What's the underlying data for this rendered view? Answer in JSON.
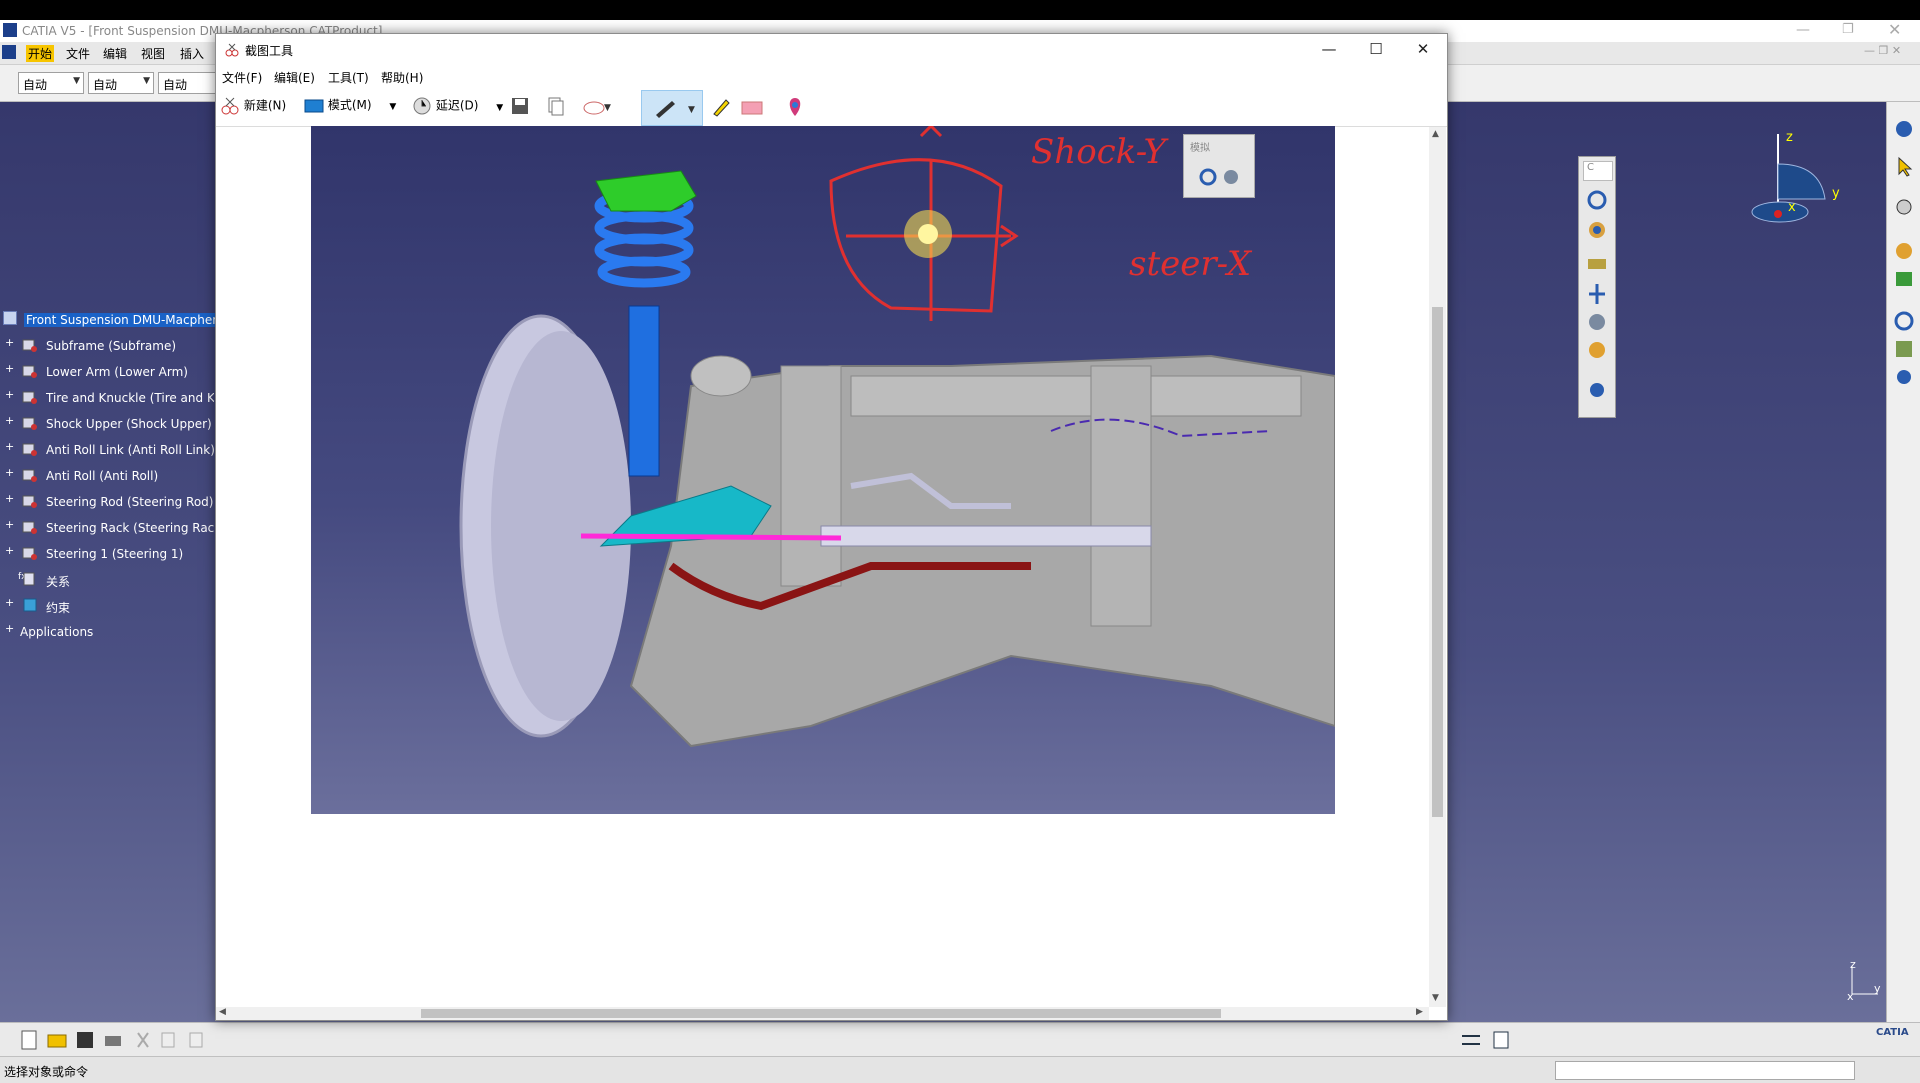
{
  "catia": {
    "title": "CATIA V5 - [Front Suspension DMU-Macpherson.CATProduct]",
    "menu": [
      "开始",
      "文件",
      "编辑",
      "视图",
      "插入"
    ],
    "combos": [
      "自动",
      "自动",
      "自动"
    ],
    "tree": {
      "root": "Front Suspension DMU-Macpherson",
      "items": [
        "Subframe (Subframe)",
        "Lower Arm (Lower Arm)",
        "Tire and Knuckle (Tire and Knuckle)",
        "Shock Upper (Shock Upper)",
        "Anti Roll Link (Anti Roll Link)",
        "Anti Roll (Anti Roll)",
        "Steering Rod (Steering Rod)",
        "Steering Rack (Steering Rack)",
        "Steering 1 (Steering 1)"
      ],
      "relations": "关系",
      "constraints": "约束",
      "applications": "Applications"
    },
    "compass": {
      "z": "z",
      "y": "y",
      "x": "x"
    },
    "axis": {
      "z": "z",
      "y": "y",
      "x": "x"
    },
    "palette_label": "C",
    "status": "选择对象或命令",
    "brand": "CATIA"
  },
  "snip": {
    "title": "截图工具",
    "menu": [
      "文件(F)",
      "编辑(E)",
      "工具(T)",
      "帮助(H)"
    ],
    "toolbar": {
      "new": "新建(N)",
      "mode": "模式(M)",
      "delay": "延迟(D)"
    },
    "capture": {
      "annotation1": "Shock-Y",
      "annotation2": "steer-X",
      "sim_panel": "模拟"
    }
  }
}
